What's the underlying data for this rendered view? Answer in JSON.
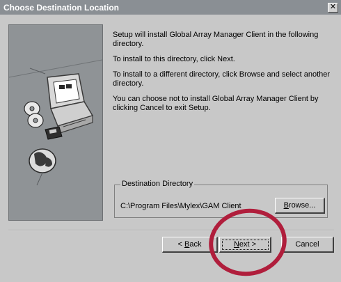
{
  "window": {
    "title": "Choose Destination Location",
    "close_glyph": "✕"
  },
  "message": {
    "p1": "Setup will install Global Array Manager Client in the following directory.",
    "p2": "To install to this directory, click Next.",
    "p3": "To install to a different directory, click Browse and select another directory.",
    "p4": "You can choose not to install Global Array Manager Client by clicking Cancel to exit Setup."
  },
  "destination": {
    "group_label": "Destination Directory",
    "path": "C:\\Program Files\\Mylex\\GAM Client",
    "browse_prefix": "",
    "browse_mnemonic": "B",
    "browse_suffix": "rowse..."
  },
  "buttons": {
    "back_prefix": "< ",
    "back_mnemonic": "B",
    "back_suffix": "ack",
    "next_mnemonic": "N",
    "next_suffix": "ext >",
    "cancel": "Cancel"
  },
  "colors": {
    "highlight_circle": "#b01e3c",
    "titlebar": "#8a8f94"
  },
  "icons": [
    "computer-icon",
    "cd-disc-icon",
    "floppy-disk-icon",
    "globe-icon"
  ]
}
